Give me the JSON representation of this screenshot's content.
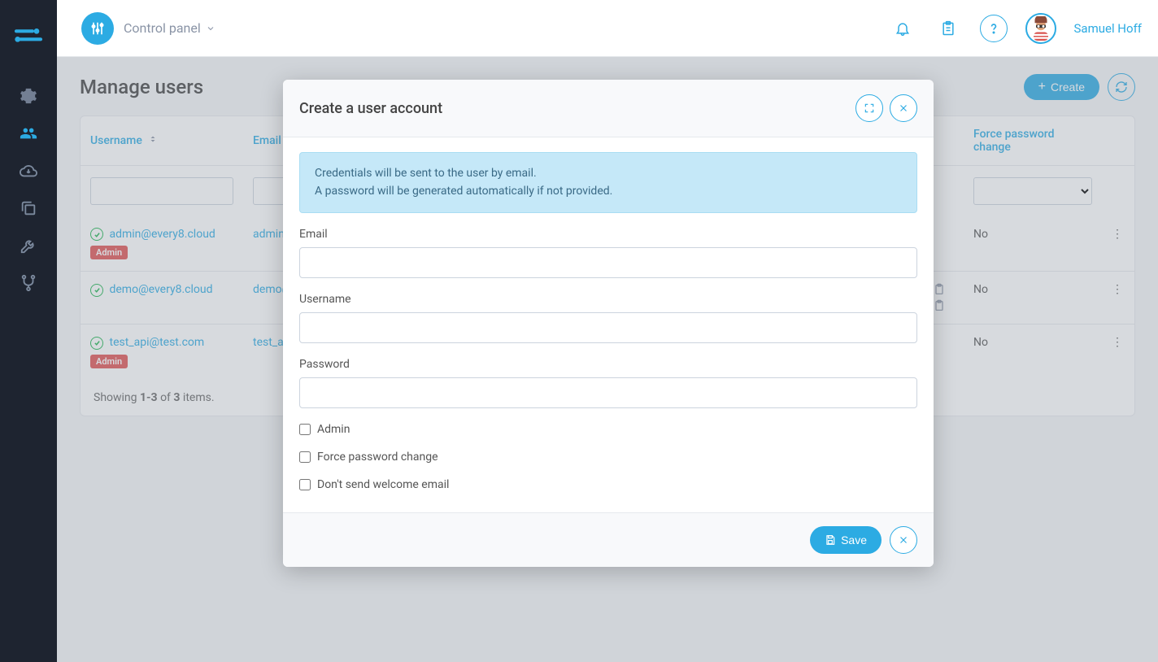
{
  "header": {
    "dropdown_title": "Control panel",
    "user_name": "Samuel Hoff"
  },
  "page": {
    "title": "Manage users",
    "create_label": "Create"
  },
  "table": {
    "columns": {
      "username": "Username",
      "email": "Email",
      "force_pw": "Force password change"
    },
    "rows": [
      {
        "username": "admin@every8.cloud",
        "email": "admin@",
        "admin_badge": "Admin",
        "force_pw": "No"
      },
      {
        "username": "demo@every8.cloud",
        "email": "demo@",
        "admin_badge": "",
        "force_pw": "No"
      },
      {
        "username": "test_api@test.com",
        "email": "test_ap",
        "admin_badge": "Admin",
        "force_pw": "No"
      }
    ],
    "footer_parts": {
      "showing": "Showing ",
      "range": "1-3",
      "of": " of ",
      "total": "3",
      "items": " items."
    }
  },
  "modal": {
    "title": "Create a user account",
    "info_line1": "Credentials will be sent to the user by email.",
    "info_line2": "A password will be generated automatically if not provided.",
    "labels": {
      "email": "Email",
      "username": "Username",
      "password": "Password",
      "admin": "Admin",
      "force_pw": "Force password change",
      "no_welcome": "Don't send welcome email"
    },
    "save_label": "Save"
  }
}
